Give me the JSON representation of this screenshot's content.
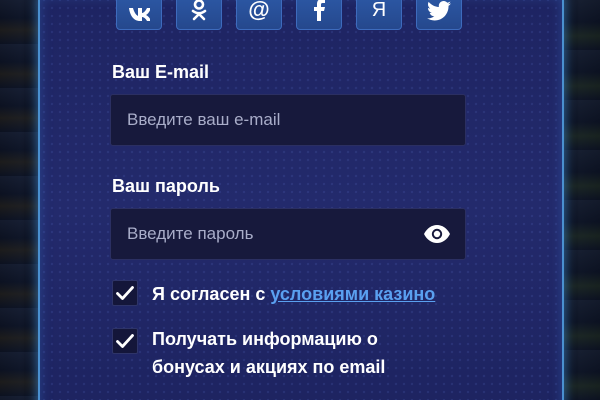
{
  "social": {
    "buttons": [
      {
        "name": "vk",
        "glyph": "vk"
      },
      {
        "name": "odnoklassniki",
        "glyph": "ok"
      },
      {
        "name": "mail",
        "glyph": "@"
      },
      {
        "name": "facebook",
        "glyph": "f"
      },
      {
        "name": "yandex",
        "glyph": "Я"
      },
      {
        "name": "twitter",
        "glyph": "twitter"
      }
    ]
  },
  "email": {
    "label": "Ваш E-mail",
    "placeholder": "Введите ваш e-mail"
  },
  "password": {
    "label": "Ваш пароль",
    "placeholder": "Введите пароль",
    "toggle_icon": "eye-icon"
  },
  "agree": {
    "checked": true,
    "text": "Я согласен с ",
    "link": "условиями казино"
  },
  "newsletter": {
    "checked": true,
    "line1": "Получать информацию о",
    "line2": "бонусах и акциях по email"
  },
  "colors": {
    "panel_bg": "#232a6c",
    "panel_border": "#4a90d0",
    "social_bg": "#2d5aa8",
    "input_bg": "#17193c",
    "link": "#5aa0f0"
  }
}
